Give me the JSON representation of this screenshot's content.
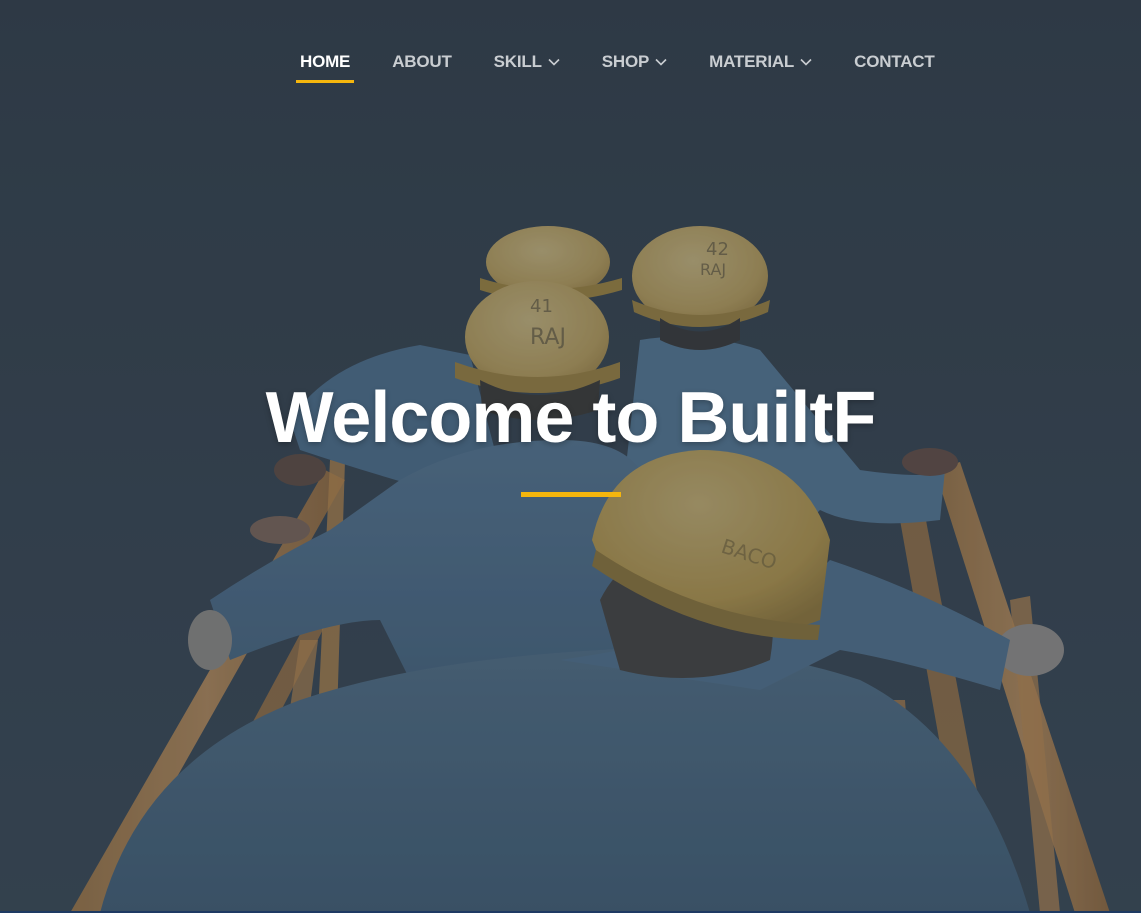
{
  "nav": {
    "items": [
      {
        "label": "HOME",
        "active": true,
        "dropdown": false
      },
      {
        "label": "ABOUT",
        "active": false,
        "dropdown": false
      },
      {
        "label": "SKILL",
        "active": false,
        "dropdown": true
      },
      {
        "label": "SHOP",
        "active": false,
        "dropdown": true
      },
      {
        "label": "MATERIAL",
        "active": false,
        "dropdown": true
      },
      {
        "label": "CONTACT",
        "active": false,
        "dropdown": false
      }
    ],
    "dropdown_icon": "chevron-down-icon"
  },
  "hero": {
    "title": "Welcome to BuiltF",
    "image": "construction-workers-in-hard-hats-climbing-stairs"
  },
  "colors": {
    "accent": "#f5b60d",
    "nav_text": "#c9cdd1",
    "nav_active_text": "#ffffff",
    "overlay": "#2f3b47"
  }
}
